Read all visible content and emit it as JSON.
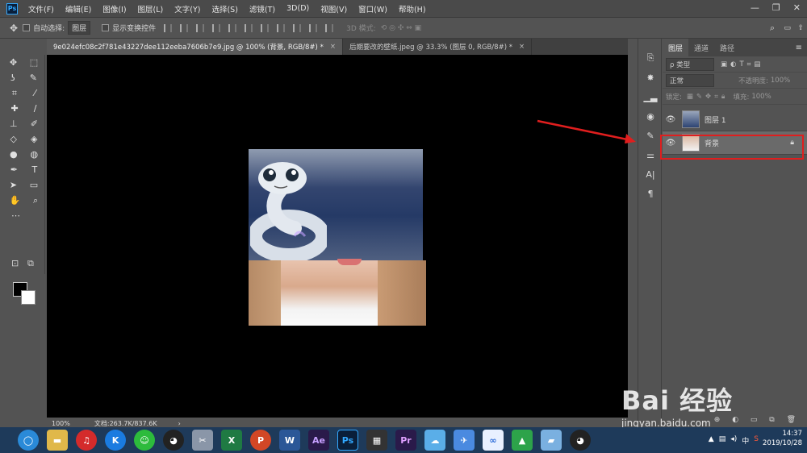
{
  "app": {
    "logo": "Ps"
  },
  "menu": [
    "文件(F)",
    "编辑(E)",
    "图像(I)",
    "图层(L)",
    "文字(Y)",
    "选择(S)",
    "滤镜(T)",
    "3D(D)",
    "视图(V)",
    "窗口(W)",
    "帮助(H)"
  ],
  "window_controls": [
    "—",
    "❐",
    "✕"
  ],
  "options": {
    "auto_select_label": "自动选择:",
    "auto_select_value": "图层",
    "transform_label": "显示变换控件",
    "mode_label": "3D 模式:"
  },
  "tabs": [
    {
      "label": "9e024efc08c2f781e43227dee112eeba7606b7e9.jpg @ 100% (背景, RGB/8#) *",
      "close": "×"
    },
    {
      "label": "后期要改的壁纸.jpeg @ 33.3% (图层 0, RGB/8#) *",
      "close": "×"
    }
  ],
  "status": {
    "zoom": "100%",
    "doc": "文档:263.7K/837.6K",
    "arrow": "›"
  },
  "layers_panel": {
    "tabs": [
      "图层",
      "通道",
      "路径"
    ],
    "filter_label": "ρ 类型",
    "blend_mode": "正常",
    "opacity_label": "不透明度:",
    "opacity_value": "100%",
    "lock_label": "锁定:",
    "fill_label": "填充:",
    "fill_value": "100%",
    "layers": [
      {
        "name": "图层 1",
        "selected": false
      },
      {
        "name": "背景",
        "selected": true,
        "locked": true
      }
    ]
  },
  "taskbar": {
    "time": "14:37",
    "date": "2019/10/28",
    "ime": "中"
  },
  "watermark": {
    "brand": "Bai 经验",
    "url": "jingyan.baidu.com"
  },
  "colors": {
    "accent_red": "#e01e1e",
    "ps_blue": "#31a8ff",
    "selected_layer": "#6a6a6a"
  }
}
